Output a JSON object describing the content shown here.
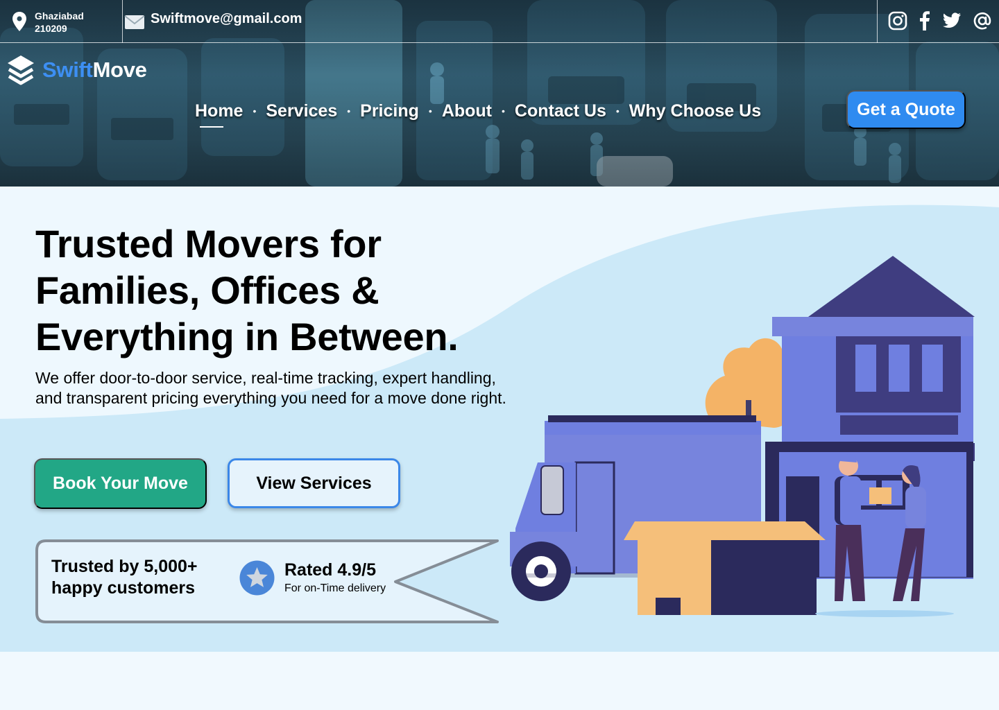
{
  "topbar": {
    "location": {
      "line1": "Ghaziabad",
      "line2": "210209"
    },
    "email": "Swiftmove@gmail.com",
    "social_icons": [
      "instagram-icon",
      "facebook-icon",
      "twitter-icon",
      "at-icon"
    ]
  },
  "brand": {
    "part1": "Swift",
    "part2": "Move",
    "accent_color": "#3d8ff3"
  },
  "nav": {
    "items": [
      {
        "label": "Home",
        "active": true
      },
      {
        "label": "Services"
      },
      {
        "label": "Pricing"
      },
      {
        "label": "About"
      },
      {
        "label": "Contact Us"
      },
      {
        "label": "Why Choose Us"
      }
    ],
    "separator": "•",
    "cta": "Get a Quote"
  },
  "hero": {
    "title_lines": [
      "Trusted Movers for",
      "Families, Offices &",
      "Everything in Between."
    ],
    "description": "We offer door-to-door service, real-time tracking, expert handling, and transparent pricing everything you need for a move done right.",
    "primary_button": "Book Your Move",
    "secondary_button": "View Services"
  },
  "trust": {
    "line1": "Trusted by 5,000+",
    "line2": "happy customers",
    "rating_title": "Rated 4.9/5",
    "rating_sub": "For on-Time delivery"
  },
  "colors": {
    "primary_blue": "#2f8bf0",
    "green": "#22a786",
    "hero_bg": "#cce9f8",
    "page_bg": "#f1f9fe",
    "illustration_purple": "#6f7fe0",
    "illustration_navy": "#2b2a5c",
    "box_orange": "#f5bf7a"
  }
}
